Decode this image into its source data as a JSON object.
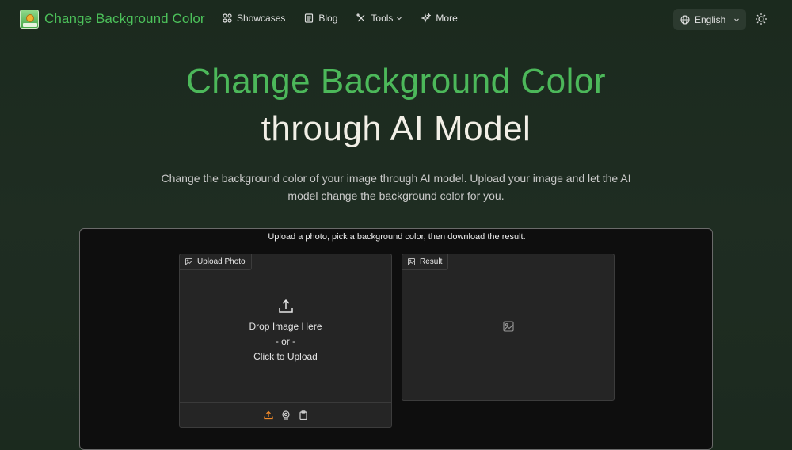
{
  "brand": {
    "title": "Change Background Color",
    "logo_icon": "landscape-logo-icon",
    "accent": "#4cc15a"
  },
  "nav": {
    "items": [
      {
        "label": "Showcases",
        "icon": "grid-icon"
      },
      {
        "label": "Blog",
        "icon": "document-icon"
      },
      {
        "label": "Tools",
        "icon": "tools-icon",
        "has_dropdown": true
      },
      {
        "label": "More",
        "icon": "sparkle-icon"
      }
    ],
    "language": "English",
    "theme_icon": "sun-icon"
  },
  "hero": {
    "line1": "Change Background Color",
    "line2": "through AI Model",
    "subtitle": "Change the background color of your image through AI model. Upload your image and let the AI model change the background color for you."
  },
  "tool": {
    "caption": "Upload a photo, pick a background color, then download the result.",
    "upload": {
      "tab_label": "Upload Photo",
      "drop_text": "Drop Image Here",
      "or_text": "- or -",
      "click_text": "Click to Upload",
      "source_icons": [
        "upload-icon",
        "webcam-icon",
        "clipboard-icon"
      ]
    },
    "result": {
      "tab_label": "Result",
      "placeholder_icon": "image-placeholder-icon"
    }
  }
}
